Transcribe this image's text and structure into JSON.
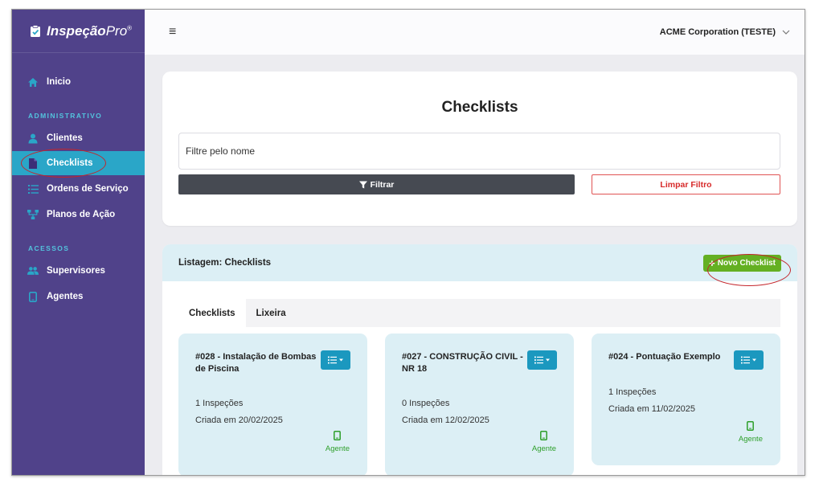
{
  "brand": {
    "name_bold": "Inspeção",
    "name_light": "Pro",
    "mark": "®"
  },
  "sidebar": {
    "home": "Inicio",
    "section_admin": "ADMINISTRATIVO",
    "items_admin": [
      "Clientes",
      "Checklists",
      "Ordens de Serviço",
      "Planos de Ação"
    ],
    "section_access": "ACESSOS",
    "items_access": [
      "Supervisores",
      "Agentes"
    ],
    "active": "Checklists"
  },
  "header": {
    "menu_icon": "≡",
    "company": "ACME Corporation (TESTE)"
  },
  "filter": {
    "title": "Checklists",
    "placeholder": "Filtre pelo nome",
    "filter_button": "Filtrar",
    "clear_button": "Limpar Filtro"
  },
  "listing": {
    "title": "Listagem: Checklists",
    "new_button": "Novo Checklist",
    "tabs": [
      "Checklists",
      "Lixeira"
    ],
    "cards": [
      {
        "title": "#028 - Instalação de Bombas de Piscina",
        "inspections": "1 Inspeções",
        "created": "Criada em 20/02/2025",
        "role": "Agente"
      },
      {
        "title": "#027 - CONSTRUÇÃO CIVIL - NR 18",
        "inspections": "0 Inspeções",
        "created": "Criada em 12/02/2025",
        "role": "Agente"
      },
      {
        "title": "#024 - Pontuação Exemplo",
        "inspections": "1 Inspeções",
        "created": "Criada em 11/02/2025",
        "role": "Agente"
      }
    ]
  },
  "colors": {
    "sidebar_bg": "#50428a",
    "sidebar_active": "#2aa6c8",
    "section_label": "#53c3dd",
    "new_button": "#64b022",
    "card_bg": "#dceff5",
    "menu_button": "#1b98bf",
    "agent_green": "#2e9f2a",
    "annotation_red": "#c4242a"
  },
  "icons": {
    "home": "home-icon",
    "clientes": "user-icon",
    "checklists": "document-icon",
    "ordens": "list-icon",
    "planos": "network-icon",
    "supervisores": "users-icon",
    "agentes": "mobile-icon"
  }
}
